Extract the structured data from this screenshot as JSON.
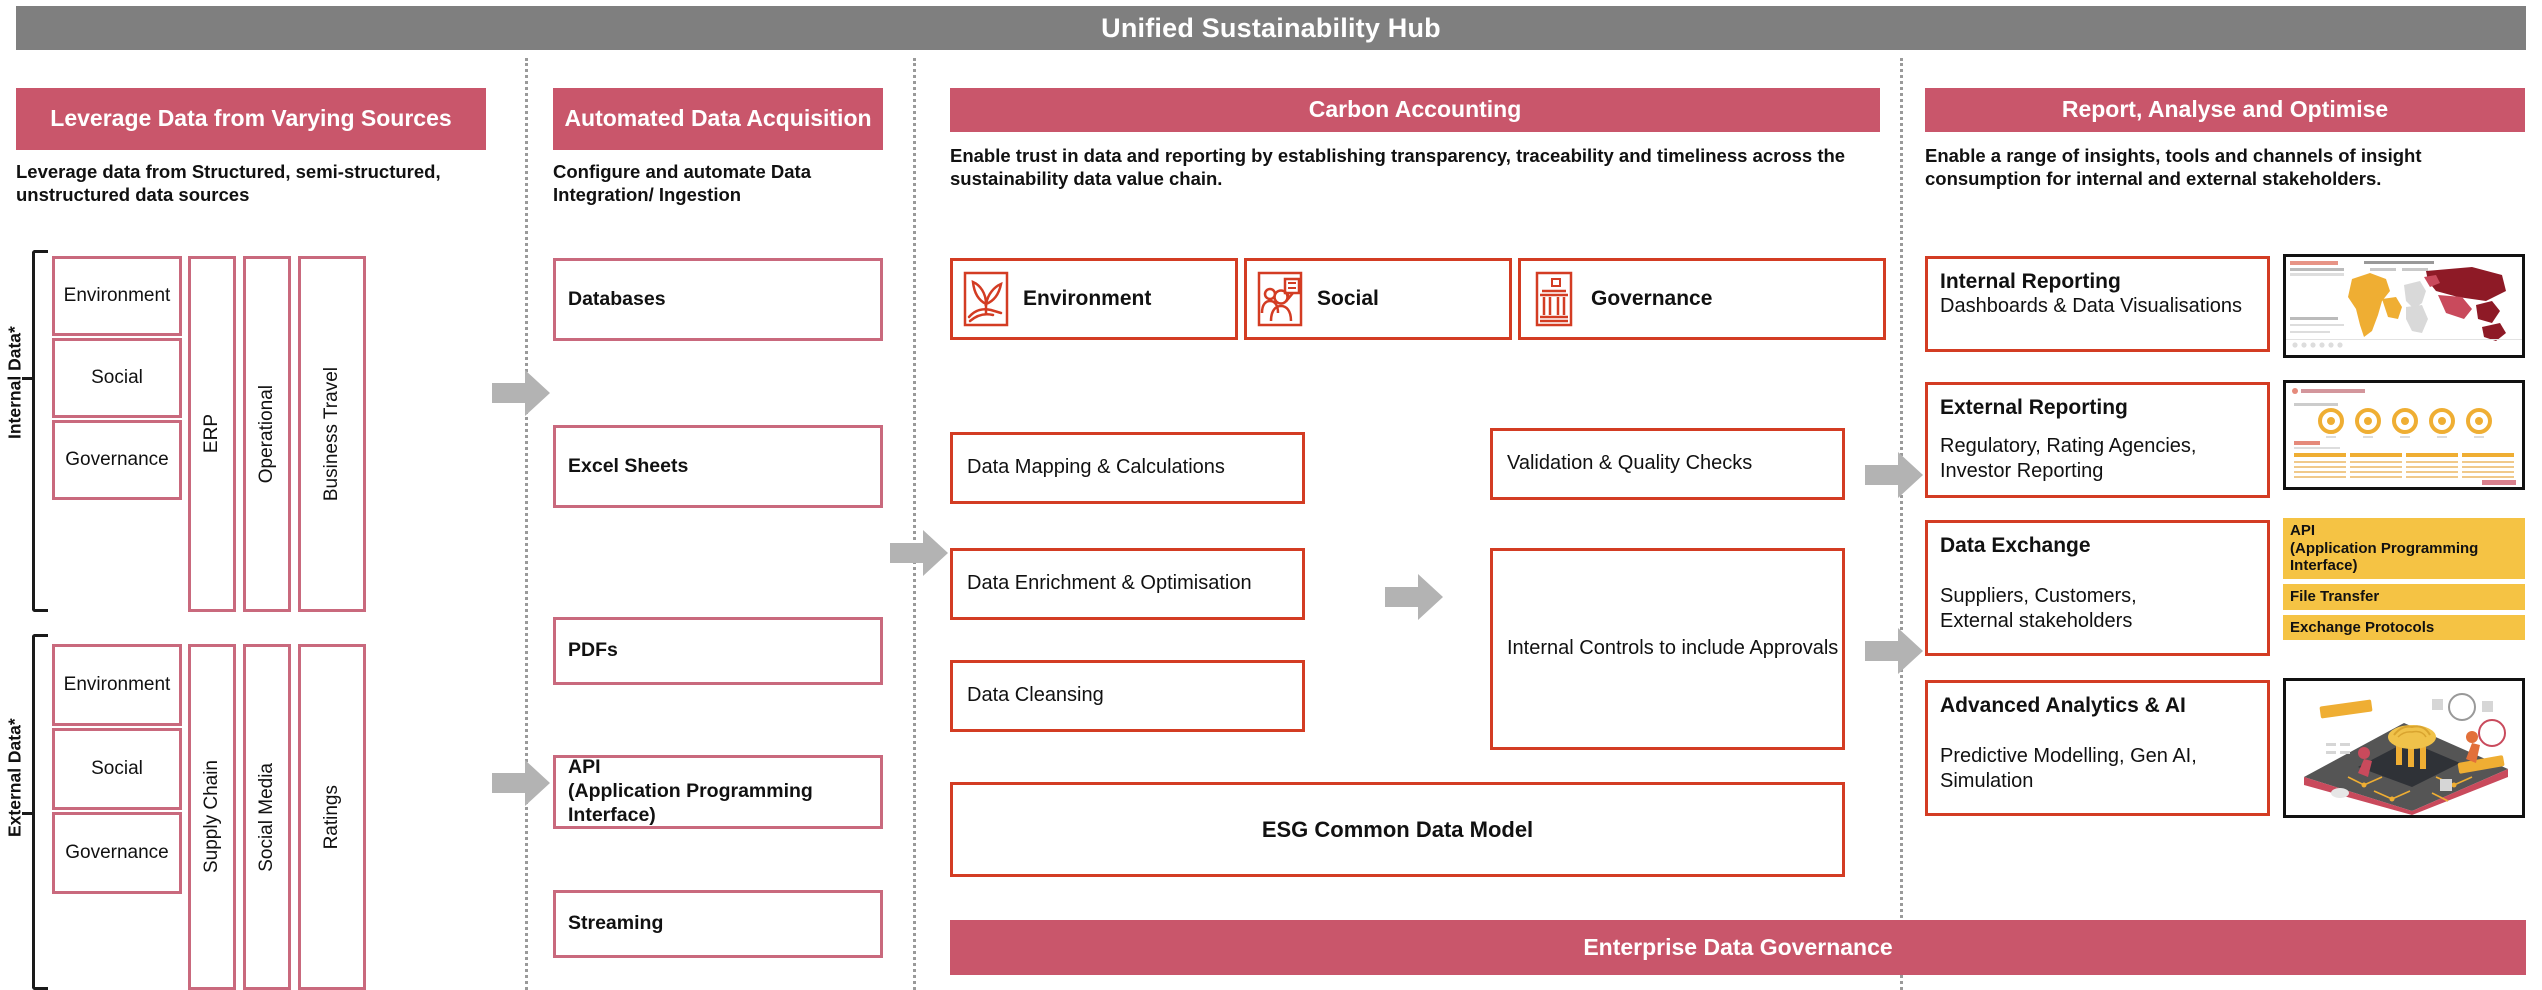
{
  "header": {
    "title": "Unified Sustainability Hub"
  },
  "colors": {
    "header_gray": "#7f7f7f",
    "accent_pink": "#c9566b",
    "box_pink": "#c9697d",
    "box_red": "#d33c23",
    "yellow": "#f5c344",
    "arrow_gray": "#b3b3b3"
  },
  "columns": {
    "sources": {
      "title": "Leverage Data from Varying Sources",
      "subtitle": "Leverage data from Structured, semi-structured, unstructured data sources",
      "groups": [
        {
          "label": "Internal Data*",
          "esg": [
            "Environment",
            "Social",
            "Governance"
          ],
          "systems": [
            "ERP",
            "Operational",
            "Business Travel"
          ]
        },
        {
          "label": "External Data*",
          "esg": [
            "Environment",
            "Social",
            "Governance"
          ],
          "systems": [
            "Supply Chain",
            "Social Media",
            "Ratings"
          ]
        }
      ]
    },
    "acquisition": {
      "title": "Automated Data Acquisition",
      "subtitle": "Configure and automate Data Integration/ Ingestion",
      "items": [
        "Databases",
        "Excel Sheets",
        "PDFs",
        "API\n(Application Programming Interface)",
        "Streaming"
      ]
    },
    "carbon": {
      "title": "Carbon Accounting",
      "subtitle": "Enable trust in data and reporting by establishing transparency, traceability and timeliness across the sustainability data value chain.",
      "esg_cards": [
        {
          "label": "Environment",
          "icon": "plant-in-hand-icon"
        },
        {
          "label": "Social",
          "icon": "people-chat-icon"
        },
        {
          "label": "Governance",
          "icon": "government-building-icon"
        }
      ],
      "left_process": [
        "Data Mapping & Calculations",
        "Data Enrichment & Optimisation",
        "Data Cleansing"
      ],
      "right_process": [
        "Validation & Quality Checks",
        "Internal Controls to include Approvals"
      ],
      "common_data_model": "ESG Common Data Model",
      "governance_bar": "Enterprise Data Governance"
    },
    "report": {
      "title": "Report, Analyse and Optimise",
      "subtitle": "Enable a range of insights, tools and channels of insight consumption for internal and external stakeholders.",
      "items": [
        {
          "title": "Internal Reporting",
          "desc": "Dashboards & Data Visualisations",
          "visual": "world-map-dashboard-thumbnail"
        },
        {
          "title": "External Reporting",
          "desc": "Regulatory, Rating Agencies,\nInvestor Reporting",
          "visual": "esg-industry-selection-thumbnail"
        },
        {
          "title": "Data Exchange",
          "desc": "Suppliers, Customers,\nExternal stakeholders",
          "visual": "yellow-channel-list"
        },
        {
          "title": "Advanced Analytics & AI",
          "desc": "Predictive Modelling, Gen AI, Simulation",
          "visual": "ai-brain-device-illustration"
        }
      ],
      "exchange_channels": [
        "API\n(Application Programming Interface)",
        "File Transfer",
        "Exchange Protocols"
      ]
    }
  }
}
